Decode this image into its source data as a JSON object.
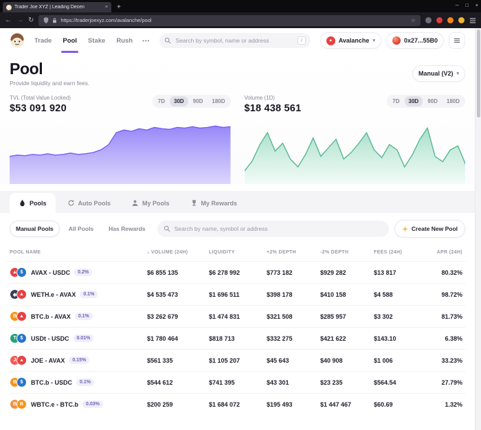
{
  "theme": {
    "accent": "#7b5cf0",
    "tvl_chart_color": "#7a5cf5",
    "volume_chart_color": "#57b694",
    "network_color": "#e84142"
  },
  "icons": {
    "close": "×",
    "minimize": "─",
    "maximize": "□",
    "plus": "+",
    "back": "←",
    "forward": "→",
    "reload": "↻",
    "star": "☆",
    "chevron": "▾",
    "sort_desc": "↓",
    "triangle": "▲",
    "more_dots": "•••"
  },
  "browser": {
    "tab_title": "Trader Joe XYZ | Leading Decen",
    "url": "https://traderjoexyz.com/avalanche/pool"
  },
  "header": {
    "nav": [
      {
        "label": "Trade",
        "active": false
      },
      {
        "label": "Pool",
        "active": true
      },
      {
        "label": "Stake",
        "active": false
      },
      {
        "label": "Rush",
        "active": false
      }
    ],
    "search_placeholder": "Search by symbol, name or address",
    "search_shortcut": "/",
    "network_label": "Avalanche",
    "wallet_address": "0x27...55B0"
  },
  "page": {
    "title": "Pool",
    "subtitle": "Provide liquidity and earn fees.",
    "mode_button": "Manual (V2)"
  },
  "stats": {
    "ranges": [
      "7D",
      "30D",
      "90D",
      "180D"
    ],
    "active_range": "30D",
    "tvl_label": "TVL (Total Value Locked)",
    "tvl_value": "$53 091 920",
    "volume_label": "Volume (1D)",
    "volume_value": "$18 438 561"
  },
  "chart_data": [
    {
      "type": "area",
      "name": "tvl",
      "title": "TVL (Total Value Locked)",
      "current_value": "$53 091 920",
      "range": "30D",
      "line_color": "#7a5cf5",
      "fill_top": "#9181f8",
      "fill_bottom": "#d6cffc",
      "points": [
        0.42,
        0.44,
        0.43,
        0.45,
        0.44,
        0.46,
        0.44,
        0.45,
        0.47,
        0.45,
        0.46,
        0.48,
        0.52,
        0.6,
        0.78,
        0.82,
        0.8,
        0.84,
        0.82,
        0.86,
        0.84,
        0.83,
        0.86,
        0.85,
        0.87,
        0.85,
        0.86,
        0.88,
        0.86,
        0.87
      ]
    },
    {
      "type": "area",
      "name": "volume",
      "title": "Volume (1D)",
      "current_value": "$18 438 561",
      "range": "30D",
      "line_color": "#57b694",
      "fill_top": "#9ddcc2",
      "fill_bottom": "#f0fbf6",
      "points": [
        0.2,
        0.35,
        0.6,
        0.78,
        0.5,
        0.62,
        0.38,
        0.26,
        0.45,
        0.7,
        0.42,
        0.55,
        0.68,
        0.38,
        0.48,
        0.62,
        0.78,
        0.52,
        0.4,
        0.6,
        0.52,
        0.26,
        0.44,
        0.68,
        0.85,
        0.42,
        0.34,
        0.52,
        0.58,
        0.3
      ]
    }
  ],
  "tabs": [
    {
      "label": "Pools",
      "icon": "droplet-icon",
      "active": true
    },
    {
      "label": "Auto Pools",
      "icon": "refresh-icon",
      "active": false
    },
    {
      "label": "My Pools",
      "icon": "user-icon",
      "active": false
    },
    {
      "label": "My Rewards",
      "icon": "trophy-icon",
      "active": false
    }
  ],
  "filters": {
    "options": [
      "Manual Pools",
      "All Pools",
      "Has Rewards"
    ],
    "active": "Manual Pools",
    "search_placeholder": "Search by name, symbol or address",
    "create_button": "Create New Pool"
  },
  "table": {
    "columns": [
      {
        "label": "POOL NAME",
        "align": "left",
        "sorted": false
      },
      {
        "label": "VOLUME (24H)",
        "align": "left",
        "sorted": true
      },
      {
        "label": "LIQUIDITY",
        "align": "left",
        "sorted": false
      },
      {
        "label": "+2% DEPTH",
        "align": "left",
        "sorted": false
      },
      {
        "label": "-2% DEPTH",
        "align": "left",
        "sorted": false
      },
      {
        "label": "FEES (24H)",
        "align": "left",
        "sorted": false
      },
      {
        "label": "APR (24H)",
        "align": "right",
        "sorted": false
      }
    ],
    "rows": [
      {
        "pair": "AVAX - USDC",
        "fee": "0.2%",
        "tokens": [
          {
            "name": "AVAX",
            "color": "#e84142",
            "glyph": "▲"
          },
          {
            "name": "USDC",
            "color": "#2775ca",
            "glyph": "$"
          }
        ],
        "values": [
          "$6 855 135",
          "$6 278 992",
          "$773 182",
          "$929 282",
          "$13 817",
          "80.32%"
        ]
      },
      {
        "pair": "WETH.e - AVAX",
        "fee": "0.1%",
        "tokens": [
          {
            "name": "WETH.e",
            "color": "#3a3d55",
            "glyph": "◆"
          },
          {
            "name": "AVAX",
            "color": "#e84142",
            "glyph": "▲"
          }
        ],
        "values": [
          "$4 535 473",
          "$1 696 511",
          "$398 178",
          "$410 158",
          "$4 588",
          "98.72%"
        ]
      },
      {
        "pair": "BTC.b - AVAX",
        "fee": "0.1%",
        "tokens": [
          {
            "name": "BTC.b",
            "color": "#f7931a",
            "glyph": "B"
          },
          {
            "name": "AVAX",
            "color": "#e84142",
            "glyph": "▲"
          }
        ],
        "values": [
          "$3 262 679",
          "$1 474 831",
          "$321 508",
          "$285 957",
          "$3 302",
          "81.73%"
        ]
      },
      {
        "pair": "USDt - USDC",
        "fee": "0.01%",
        "tokens": [
          {
            "name": "USDt",
            "color": "#26a17b",
            "glyph": "T"
          },
          {
            "name": "USDC",
            "color": "#2775ca",
            "glyph": "$"
          }
        ],
        "values": [
          "$1 780 464",
          "$818 713",
          "$332 275",
          "$421 622",
          "$143.10",
          "6.38%"
        ]
      },
      {
        "pair": "JOE - AVAX",
        "fee": "0.15%",
        "tokens": [
          {
            "name": "JOE",
            "color": "#f25c54",
            "glyph": "J"
          },
          {
            "name": "AVAX",
            "color": "#e84142",
            "glyph": "▲"
          }
        ],
        "values": [
          "$561 335",
          "$1 105 207",
          "$45 643",
          "$40 908",
          "$1 006",
          "33.23%"
        ]
      },
      {
        "pair": "BTC.b - USDC",
        "fee": "0.1%",
        "tokens": [
          {
            "name": "BTC.b",
            "color": "#f7931a",
            "glyph": "B"
          },
          {
            "name": "USDC",
            "color": "#2775ca",
            "glyph": "$"
          }
        ],
        "values": [
          "$544 612",
          "$741 395",
          "$43 301",
          "$23 235",
          "$564.54",
          "27.79%"
        ]
      },
      {
        "pair": "WBTC.e - BTC.b",
        "fee": "0.03%",
        "tokens": [
          {
            "name": "WBTC.e",
            "color": "#f09242",
            "glyph": "B"
          },
          {
            "name": "BTC.b",
            "color": "#f7931a",
            "glyph": "B"
          }
        ],
        "values": [
          "$200 259",
          "$1 684 072",
          "$195 493",
          "$1 447 467",
          "$60.69",
          "1.32%"
        ]
      }
    ]
  }
}
